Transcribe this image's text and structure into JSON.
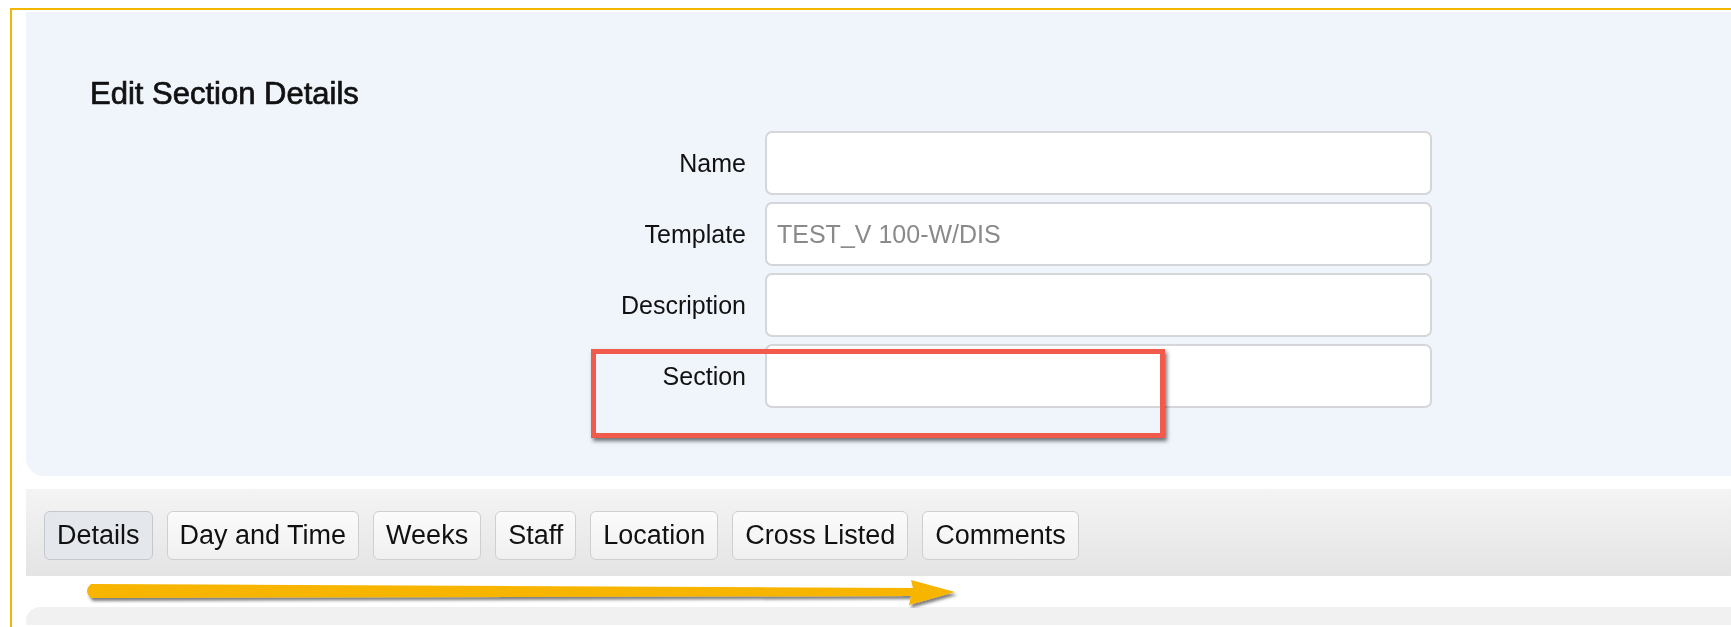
{
  "title": "Edit Section Details",
  "fields": [
    {
      "label": "Name"
    },
    {
      "label": "Template",
      "value": "TEST_V 100-W/DIS",
      "disabled": true
    },
    {
      "label": "Description"
    },
    {
      "label": "Section"
    }
  ],
  "tabs": [
    {
      "label": "Details",
      "selected": true
    },
    {
      "label": "Day and Time",
      "selected": false
    },
    {
      "label": "Weeks",
      "selected": false
    },
    {
      "label": "Staff",
      "selected": false
    },
    {
      "label": "Location",
      "selected": false
    },
    {
      "label": "Cross Listed",
      "selected": false
    },
    {
      "label": "Comments",
      "selected": false
    }
  ],
  "annotations": [
    {
      "kind": "box"
    },
    {
      "kind": "arrow"
    }
  ]
}
